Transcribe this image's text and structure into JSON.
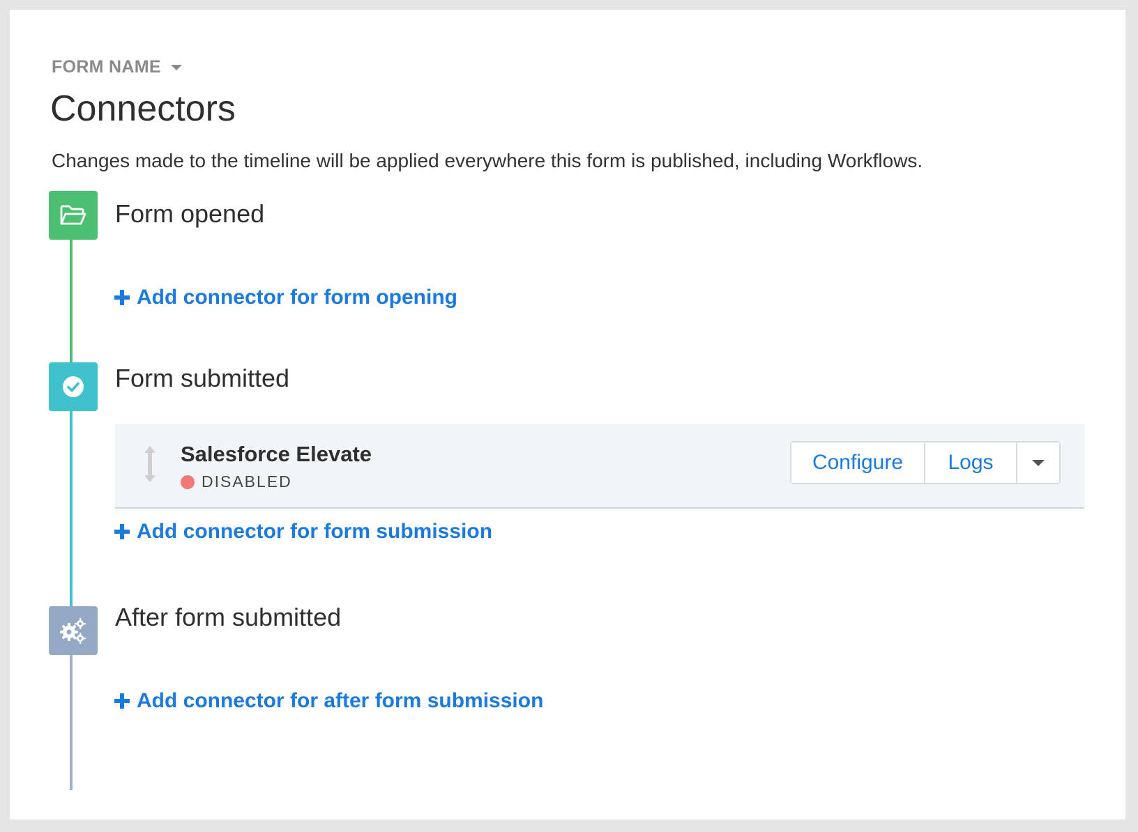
{
  "header": {
    "form_name": "FORM NAME",
    "title": "Connectors",
    "description": "Changes made to the timeline will be applied everywhere this form is published, including Workflows."
  },
  "stages": [
    {
      "label": "Form opened",
      "icon": "folder-open-icon",
      "color": "#4cbf72",
      "add_link": "Add connector for form opening"
    },
    {
      "label": "Form submitted",
      "icon": "check-circle-icon",
      "color": "#3fc2cc",
      "add_link": "Add connector for form submission",
      "connectors": [
        {
          "name": "Salesforce Elevate",
          "status": "DISABLED",
          "status_color": "#f07878",
          "actions": {
            "configure": "Configure",
            "logs": "Logs"
          }
        }
      ]
    },
    {
      "label": "After form submitted",
      "icon": "gears-icon",
      "color": "#96a9c4",
      "add_link": "Add connector for after form submission"
    }
  ],
  "accent_color": "#1a7ae0"
}
